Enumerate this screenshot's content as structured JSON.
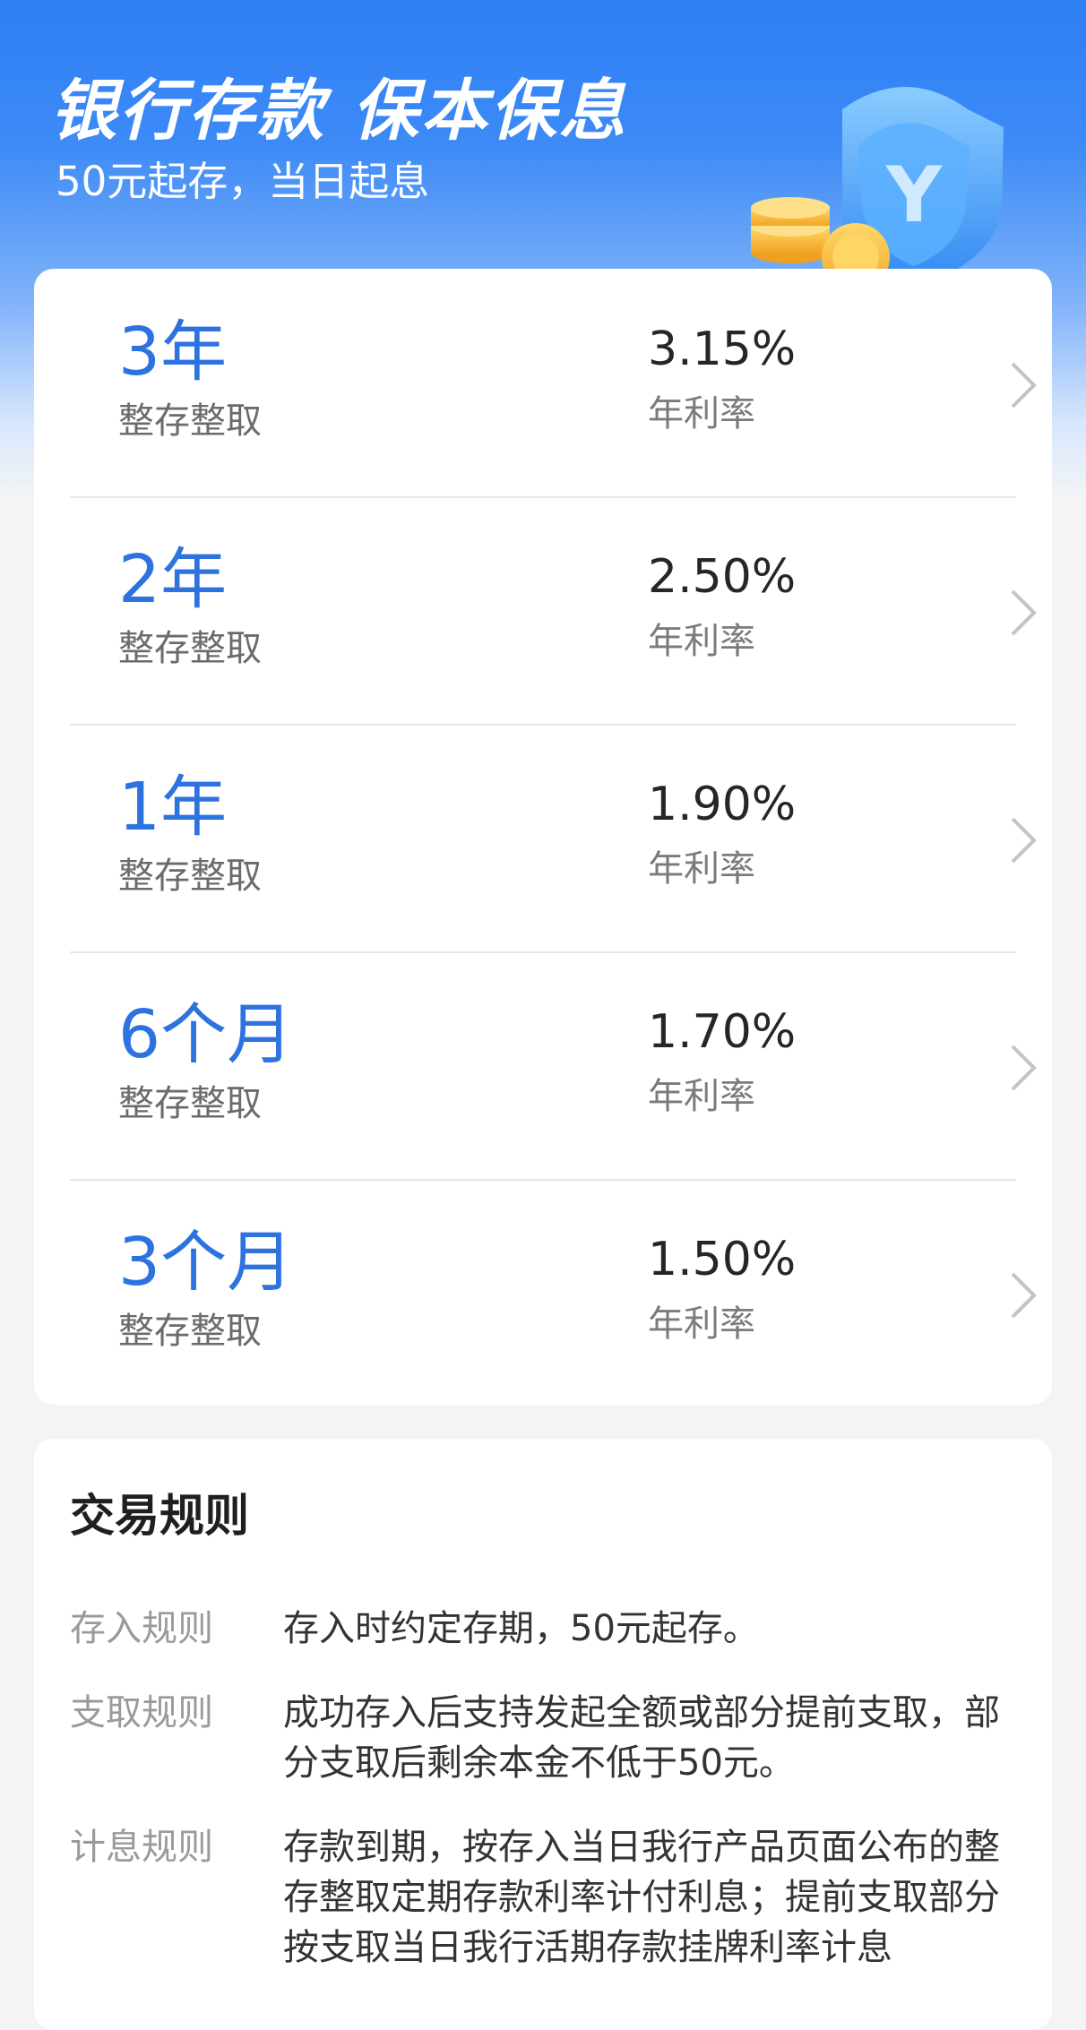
{
  "hero": {
    "title": "银行存款 保本保息",
    "subtitle": "50元起存，当日起息",
    "illustration_icon": "shield-coins-icon",
    "illustration_letter": "Y"
  },
  "products": [
    {
      "term": "3年",
      "type": "整存整取",
      "rate": "3.15%",
      "rate_label": "年利率"
    },
    {
      "term": "2年",
      "type": "整存整取",
      "rate": "2.50%",
      "rate_label": "年利率"
    },
    {
      "term": "1年",
      "type": "整存整取",
      "rate": "1.90%",
      "rate_label": "年利率"
    },
    {
      "term": "6个月",
      "type": "整存整取",
      "rate": "1.70%",
      "rate_label": "年利率"
    },
    {
      "term": "3个月",
      "type": "整存整取",
      "rate": "1.50%",
      "rate_label": "年利率"
    }
  ],
  "rules": {
    "title": "交易规则",
    "items": [
      {
        "label": "存入规则",
        "text": "存入时约定存期，50元起存。"
      },
      {
        "label": "支取规则",
        "text": "成功存入后支持发起全额或部分提前支取，部分支取后剩余本金不低于50元。"
      },
      {
        "label": "计息规则",
        "text": "存款到期，按存入当日我行产品页面公布的整存整取定期存款利率计付利息；提前支取部分按支取当日我行活期存款挂牌利率计息"
      }
    ]
  },
  "colors": {
    "primary": "#2f7ff5",
    "term_text": "#2d73e0",
    "background": "#f4f4f4"
  }
}
